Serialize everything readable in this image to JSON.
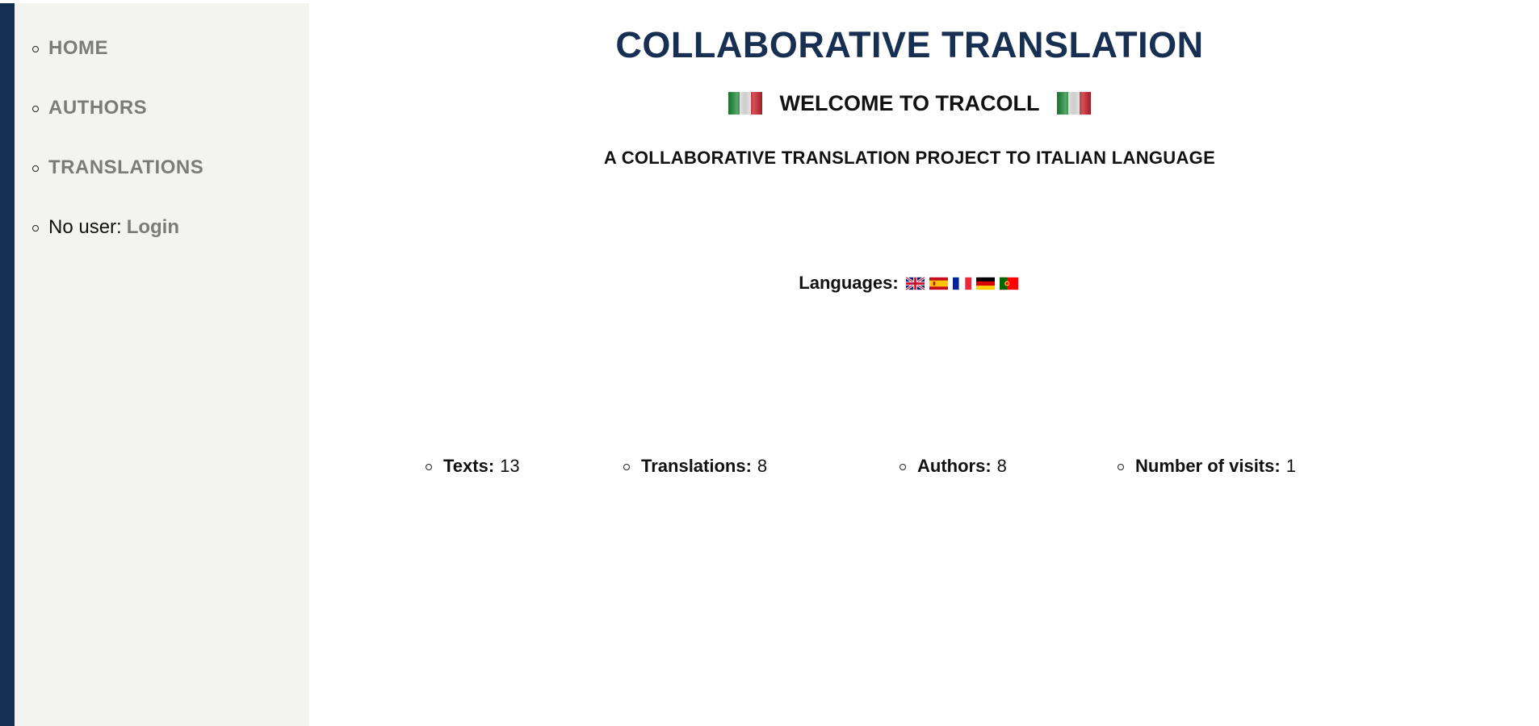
{
  "sidebar": {
    "items": [
      {
        "label": "HOME"
      },
      {
        "label": "AUTHORS"
      },
      {
        "label": "TRANSLATIONS"
      }
    ],
    "user_status": "No user:",
    "login_label": "Login"
  },
  "header": {
    "title": "COLLABORATIVE TRANSLATION",
    "welcome": "WELCOME TO TRACOLL",
    "subtitle": "A COLLABORATIVE TRANSLATION PROJECT TO ITALIAN LANGUAGE"
  },
  "languages": {
    "label": "Languages:",
    "flags": [
      "uk-flag-icon",
      "spain-flag-icon",
      "france-flag-icon",
      "germany-flag-icon",
      "portugal-flag-icon"
    ]
  },
  "stats": [
    {
      "label": "Texts:",
      "value": "13"
    },
    {
      "label": "Translations:",
      "value": "8"
    },
    {
      "label": "Authors:",
      "value": "8"
    },
    {
      "label": "Number of visits:",
      "value": "1"
    }
  ],
  "colors": {
    "accent": "#142e52",
    "sidebar_bg": "#f3f3ef",
    "nav_link": "#7b7b7b"
  }
}
